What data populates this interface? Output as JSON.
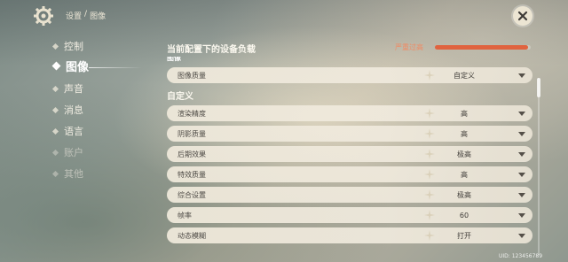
{
  "breadcrumb": [
    "设置",
    "/",
    "图像"
  ],
  "sidebar": {
    "items": [
      {
        "label": "控制"
      },
      {
        "label": "图像"
      },
      {
        "label": "声音"
      },
      {
        "label": "消息"
      },
      {
        "label": "语言"
      },
      {
        "label": "账户"
      },
      {
        "label": "其他"
      }
    ]
  },
  "panel": {
    "title": "当前配置下的设备负载",
    "load_label": "严重过高",
    "load_level": 0.97,
    "load_color": "#e0633f"
  },
  "sections": {
    "peek_label": "图像",
    "custom_label": "自定义"
  },
  "rows": [
    {
      "label": "图像质量",
      "value": "自定义"
    },
    {
      "label": "渲染精度",
      "value": "高"
    },
    {
      "label": "阴影质量",
      "value": "高"
    },
    {
      "label": "后期效果",
      "value": "极高"
    },
    {
      "label": "特效质量",
      "value": "高"
    },
    {
      "label": "综合设置",
      "value": "极高"
    },
    {
      "label": "帧率",
      "value": "60"
    },
    {
      "label": "动态模糊",
      "value": "打开"
    }
  ],
  "uid": "UID: 123456789",
  "icons": {
    "settings": "gear-icon",
    "close": "close-icon",
    "dropdown": "chevron-down-icon"
  }
}
